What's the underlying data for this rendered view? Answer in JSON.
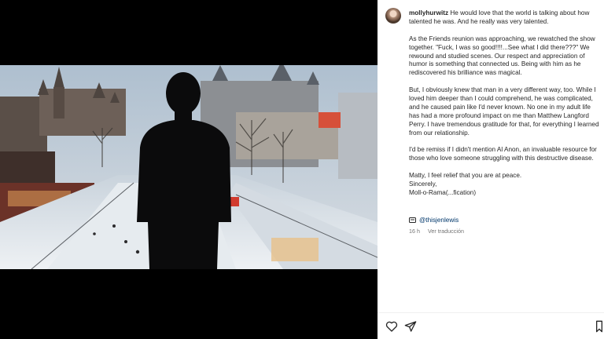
{
  "post": {
    "username": "mollyhurwitz",
    "caption_paragraphs": [
      "He would love that the world is talking about how talented he was. And he really was very talented.",
      "As the Friends reunion was approaching, we rewatched the show together. \"Fuck, I was so good!!!!...See what I did there???\" We rewound and studied scenes. Our respect and appreciation of humor is something that connected us. Being with him as he rediscovered his brilliance was magical.",
      "But, I obviously knew that man in a very different way, too. While I loved him deeper than I could comprehend, he was complicated, and he caused pain like I'd never known. No one in my adult life has had a more profound impact on me than Matthew Langford Perry. I have tremendous gratitude for that, for everything I learned from our relationship.",
      "I'd be remiss if I didn't mention Al Anon, an invaluable resource for those who love someone struggling with this destructive disease."
    ],
    "closing_lines": [
      "Matty, I feel relief that you are at peace.",
      "Sincerely,",
      "Moll-o-Rama(...fication)"
    ],
    "tag": "@thisjenlewis",
    "time_ago": "16 h",
    "translation_link": "Ver traducción"
  },
  "icons": {
    "like": "heart-icon",
    "share": "paper-plane-icon",
    "save": "bookmark-icon",
    "tag": "comment-tag-icon"
  },
  "colors": {
    "link": "#00376b",
    "text": "#262626",
    "secondary": "#737373"
  }
}
